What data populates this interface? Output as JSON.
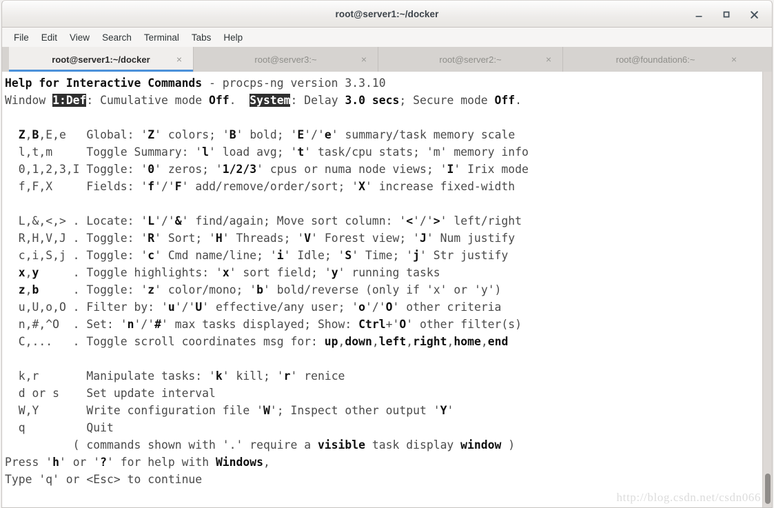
{
  "window": {
    "title": "root@server1:~/docker",
    "controls": [
      {
        "name": "minimize",
        "glyph": "_"
      },
      {
        "name": "maximize",
        "glyph": "□"
      },
      {
        "name": "close",
        "glyph": "✕"
      }
    ]
  },
  "menubar": {
    "items": [
      {
        "label": "File"
      },
      {
        "label": "Edit"
      },
      {
        "label": "View"
      },
      {
        "label": "Search"
      },
      {
        "label": "Terminal"
      },
      {
        "label": "Tabs"
      },
      {
        "label": "Help"
      }
    ]
  },
  "tabs": [
    {
      "label": "root@server1:~/docker",
      "active": true,
      "close": "×"
    },
    {
      "label": "root@server3:~",
      "active": false,
      "close": "×"
    },
    {
      "label": "root@server2:~",
      "active": false,
      "close": "×"
    },
    {
      "label": "root@foundation6:~",
      "active": false,
      "close": "×"
    }
  ],
  "terminal": {
    "program": "top",
    "lines": [
      "<b>Help for Interactive Commands</b> - procps-ng version 3.3.10",
      "Window <span class=\"rev\">1:Def</span>: Cumulative mode <b>Off</b>.  <span class=\"rev\">System</span>: Delay <b>3.0 secs</b>; Secure mode <b>Off</b>.",
      "",
      "  <b>Z</b>,<b>B</b>,E,e   Global: '<b>Z</b>' colors; '<b>B</b>' bold; '<b>E</b>'/'<b>e</b>' summary/task memory scale",
      "  l,t,m     Toggle Summary: '<b>l</b>' load avg; '<b>t</b>' task/cpu stats; 'm' memory info",
      "  0,1,2,3,I Toggle: '<b>0</b>' zeros; '<b>1/2/3</b>' cpus or numa node views; '<b>I</b>' Irix mode",
      "  f,F,X     Fields: '<b>f</b>'/'<b>F</b>' add/remove/order/sort; '<b>X</b>' increase fixed-width",
      "",
      "  L,&amp;,&lt;,&gt; . Locate: '<b>L</b>'/'<b>&amp;</b>' find/again; Move sort column: '<b>&lt;</b>'/'<b>&gt;</b>' left/right",
      "  R,H,V,J . Toggle: '<b>R</b>' Sort; '<b>H</b>' Threads; '<b>V</b>' Forest view; '<b>J</b>' Num justify",
      "  c,i,S,j . Toggle: '<b>c</b>' Cmd name/line; '<b>i</b>' Idle; '<b>S</b>' Time; '<b>j</b>' Str justify",
      "  <b>x</b>,<b>y</b>     . Toggle highlights: '<b>x</b>' sort field; '<b>y</b>' running tasks",
      "  <b>z</b>,<b>b</b>     . Toggle: '<b>z</b>' color/mono; '<b>b</b>' bold/reverse (only if 'x' or 'y')",
      "  u,U,o,O . Filter by: '<b>u</b>'/'<b>U</b>' effective/any user; '<b>o</b>'/'<b>O</b>' other criteria",
      "  n,#,^O  . Set: '<b>n</b>'/'<b>#</b>' max tasks displayed; Show: <b>Ctrl</b>+'<b>O</b>' other filter(s)",
      "  C,...   . Toggle scroll coordinates msg for: <b>up</b>,<b>down</b>,<b>left</b>,<b>right</b>,<b>home</b>,<b>end</b>",
      "",
      "  k,r       Manipulate tasks: '<b>k</b>' kill; '<b>r</b>' renice",
      "  d or s    Set update interval",
      "  W,Y       Write configuration file '<b>W</b>'; Inspect other output '<b>Y</b>'",
      "  q         Quit",
      "          ( commands shown with '.' require a <b>visible</b> task display <b>window</b> )",
      "Press '<b>h</b>' or '<b>?</b>' for help with <b>Windows</b>,",
      "Type 'q' or &lt;Esc&gt; to continue"
    ]
  },
  "watermark": {
    "text": "http://blog.csdn.net/csdn066"
  }
}
